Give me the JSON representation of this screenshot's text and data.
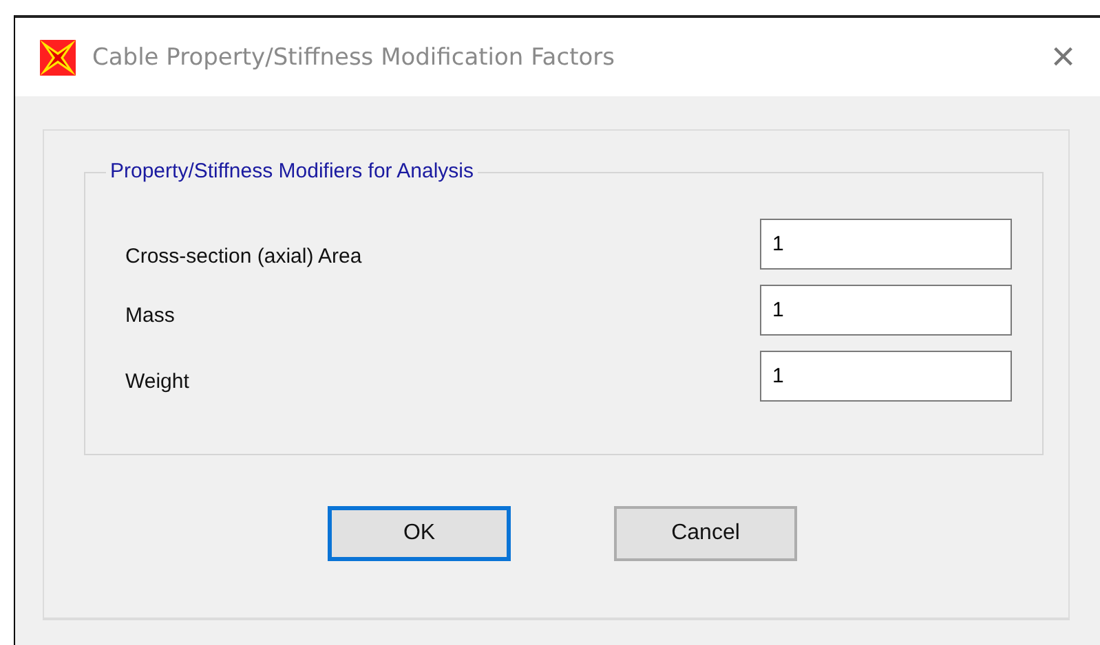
{
  "window": {
    "title": "Cable Property/Stiffness Modification Factors",
    "close": "×"
  },
  "group": {
    "title": "Property/Stiffness Modifiers for Analysis",
    "fields": [
      {
        "label": "Cross-section (axial) Area",
        "value": "1"
      },
      {
        "label": "Mass",
        "value": "1"
      },
      {
        "label": "Weight",
        "value": "1"
      }
    ]
  },
  "buttons": [
    {
      "label": "OK",
      "focused": true
    },
    {
      "label": "Cancel",
      "focused": false
    }
  ]
}
